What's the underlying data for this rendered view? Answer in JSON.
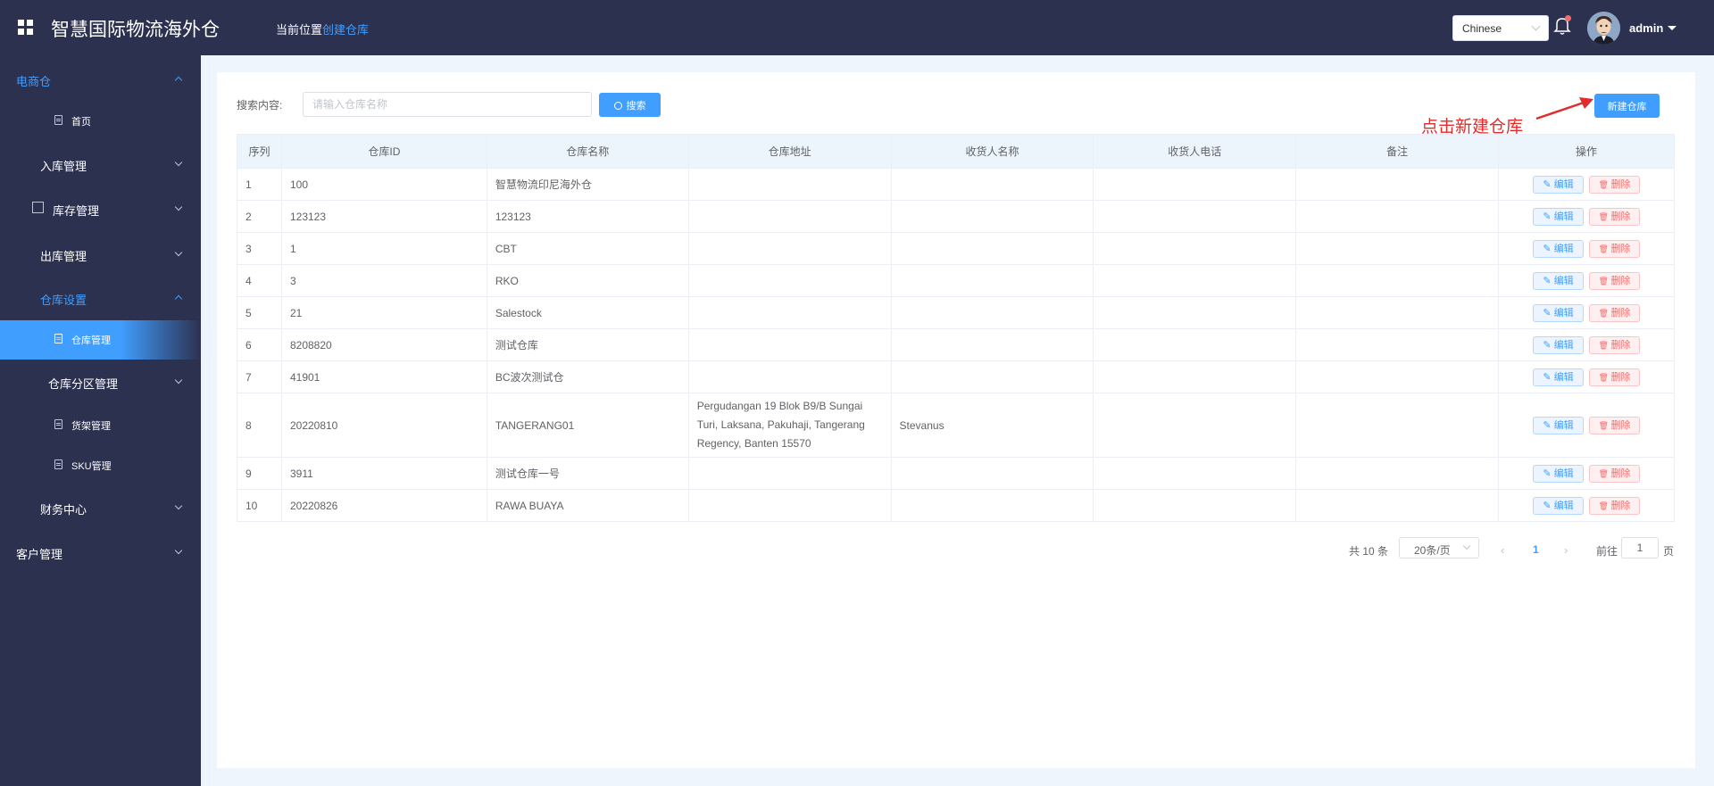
{
  "header": {
    "title": "智慧国际物流海外仓",
    "breadcrumb_prefix": "当前位置",
    "breadcrumb_current": "创建仓库",
    "language": "Chinese",
    "user": "admin"
  },
  "sidebar": {
    "items": [
      {
        "label": "电商仓"
      },
      {
        "label": "首页"
      },
      {
        "label": "入库管理"
      },
      {
        "label": "库存管理"
      },
      {
        "label": "出库管理"
      },
      {
        "label": "仓库设置"
      },
      {
        "label": "仓库管理"
      },
      {
        "label": "仓库分区管理"
      },
      {
        "label": "货架管理"
      },
      {
        "label": "SKU管理"
      },
      {
        "label": "财务中心"
      },
      {
        "label": "客户管理"
      }
    ]
  },
  "search": {
    "label": "搜索内容:",
    "placeholder": "请输入仓库名称",
    "button": "搜索"
  },
  "toolbar": {
    "new_button": "新建仓库",
    "annotation": "点击新建仓库"
  },
  "table": {
    "columns": [
      "序列",
      "仓库ID",
      "仓库名称",
      "仓库地址",
      "收货人名称",
      "收货人电话",
      "备注",
      "操作"
    ],
    "edit_label": "编辑",
    "delete_label": "删除",
    "rows": [
      {
        "index": "1",
        "id": "100",
        "name": "智慧物流印尼海外仓",
        "address": "",
        "receiver": "",
        "phone": "",
        "remark": ""
      },
      {
        "index": "2",
        "id": "123123",
        "name": "123123",
        "address": "",
        "receiver": "",
        "phone": "",
        "remark": ""
      },
      {
        "index": "3",
        "id": "1",
        "name": "CBT",
        "address": "",
        "receiver": "",
        "phone": "",
        "remark": ""
      },
      {
        "index": "4",
        "id": "3",
        "name": "RKO",
        "address": "",
        "receiver": "",
        "phone": "",
        "remark": ""
      },
      {
        "index": "5",
        "id": "21",
        "name": "Salestock",
        "address": "",
        "receiver": "",
        "phone": "",
        "remark": ""
      },
      {
        "index": "6",
        "id": "8208820",
        "name": "测试仓库",
        "address": "",
        "receiver": "",
        "phone": "",
        "remark": ""
      },
      {
        "index": "7",
        "id": "41901",
        "name": "BC波次测试仓",
        "address": "",
        "receiver": "",
        "phone": "",
        "remark": ""
      },
      {
        "index": "8",
        "id": "20220810",
        "name": "TANGERANG01",
        "address": "Pergudangan 19 Blok B9/B Sungai Turi, Laksana, Pakuhaji, Tangerang Regency, Banten 15570",
        "receiver": "Stevanus",
        "phone": "",
        "remark": ""
      },
      {
        "index": "9",
        "id": "3911",
        "name": "测试仓库一号",
        "address": "",
        "receiver": "",
        "phone": "",
        "remark": ""
      },
      {
        "index": "10",
        "id": "20220826",
        "name": "RAWA BUAYA",
        "address": "",
        "receiver": "",
        "phone": "",
        "remark": ""
      }
    ]
  },
  "pagination": {
    "total": "共 10 条",
    "page_size": "20条/页",
    "current_page": "1",
    "goto_label": "前往",
    "goto_value": "1",
    "page_suffix": "页"
  },
  "colors": {
    "header_bg": "#2c3150",
    "accent": "#409eff",
    "danger": "#f56c6c",
    "annotation": "#e32b2b"
  }
}
